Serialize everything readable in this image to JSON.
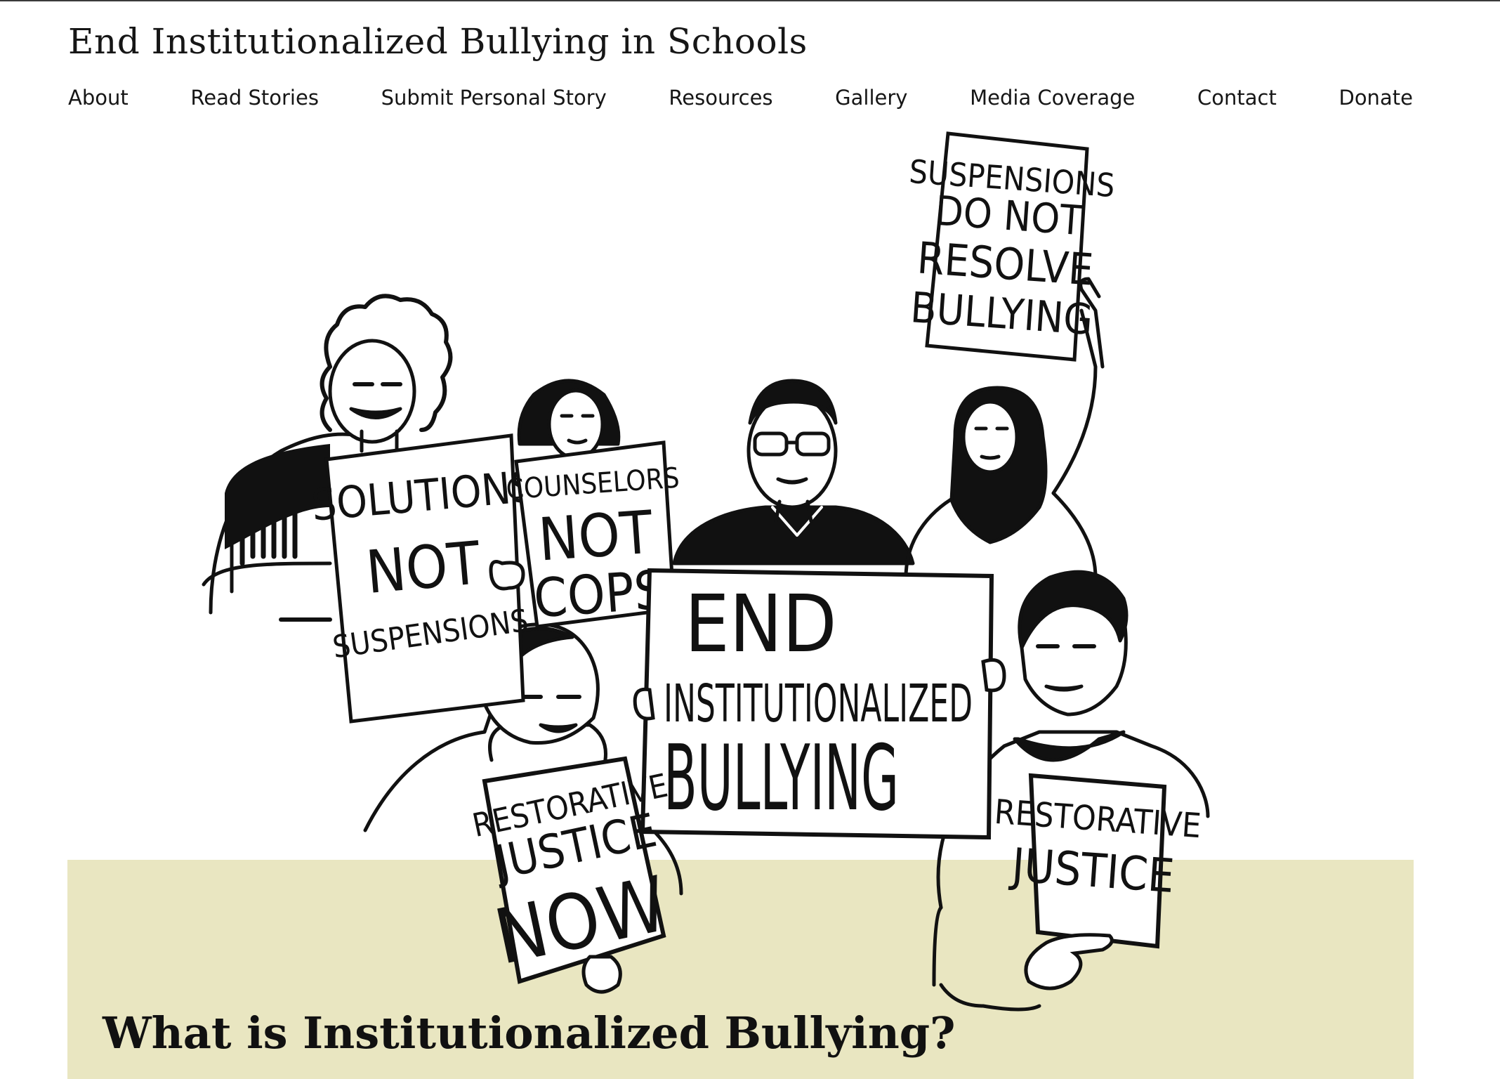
{
  "site": {
    "title": "End Institutionalized Bullying in Schools"
  },
  "nav": {
    "items": [
      {
        "label": "About"
      },
      {
        "label": "Read Stories"
      },
      {
        "label": "Submit Personal Story"
      },
      {
        "label": "Resources"
      },
      {
        "label": "Gallery"
      },
      {
        "label": "Media Coverage"
      },
      {
        "label": "Contact"
      },
      {
        "label": "Donate"
      }
    ]
  },
  "hero": {
    "signs": {
      "suspensions": [
        "SUSPENSIONS",
        "DO NOT",
        "RESOLVE",
        "BULLYING"
      ],
      "solutions": [
        "SOLUTIONS",
        "NOT",
        "SUSPENSIONS"
      ],
      "counselors": [
        "COUNSELORS",
        "NOT",
        "COPS"
      ],
      "end": [
        "END",
        "INSTITUTIONALIZED",
        "BULLYING"
      ],
      "restorative_now": [
        "RESTORATIVE",
        "JUSTICE",
        "NOW"
      ],
      "restorative": [
        "RESTORATIVE",
        "JUSTICE"
      ]
    }
  },
  "main": {
    "section_title": "What is Institutionalized Bullying?"
  },
  "colors": {
    "band": "#e9e6c1",
    "ink": "#111111",
    "background": "#ffffff"
  }
}
